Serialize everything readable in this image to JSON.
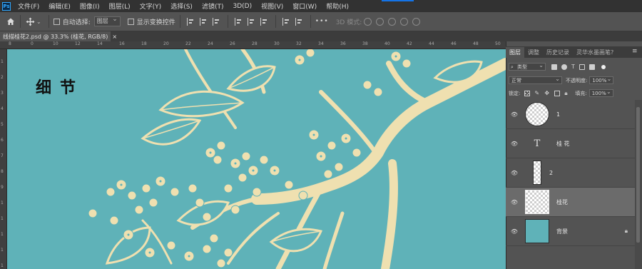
{
  "app": {
    "logo": "Ps"
  },
  "menu": [
    "文件(F)",
    "编辑(E)",
    "图像(I)",
    "图层(L)",
    "文字(Y)",
    "选择(S)",
    "滤镜(T)",
    "3D(D)",
    "视图(V)",
    "窗口(W)",
    "帮助(H)"
  ],
  "options": {
    "auto_select_label": "自动选择:",
    "auto_select_value": "图层",
    "transform_controls_label": "显示变换控件",
    "more_label": "•••",
    "mode_3d_label": "3D 模式:"
  },
  "document": {
    "tab_title": "线描桂花2.psd @ 33.3% (桂花, RGB/8)",
    "close": "×",
    "canvas_title": "细节",
    "bg_color": "#5fb2b8",
    "line_color": "#efe0b0"
  },
  "rulers": {
    "top": [
      "8",
      "0",
      "10",
      "12",
      "14",
      "16",
      "18",
      "20",
      "22",
      "24",
      "26",
      "28",
      "30",
      "32",
      "34",
      "36",
      "38",
      "40",
      "42",
      "44",
      "46",
      "48",
      "50"
    ],
    "left": [
      "1",
      "2",
      "3",
      "4",
      "5",
      "6",
      "7",
      "8",
      "9",
      "1",
      "1",
      "1",
      "1",
      "1"
    ]
  },
  "panel": {
    "tabs": [
      "图层",
      "调整",
      "历史记录",
      "灵华水墨画笔?"
    ],
    "menu_icon": "≡",
    "filter_label": "类型",
    "blend_mode": "正常",
    "opacity_label": "不透明度:",
    "opacity_value": "100%",
    "lock_label": "锁定:",
    "fill_label": "填充:",
    "fill_value": "100%",
    "layers": [
      {
        "name": "1",
        "kind": "image"
      },
      {
        "name": "桂 花",
        "kind": "text",
        "glyph": "T"
      },
      {
        "name": "2",
        "kind": "image"
      },
      {
        "name": "桂花",
        "kind": "image",
        "selected": true
      },
      {
        "name": "背景",
        "kind": "background",
        "locked": true,
        "color": "#5fb2b8"
      }
    ]
  }
}
